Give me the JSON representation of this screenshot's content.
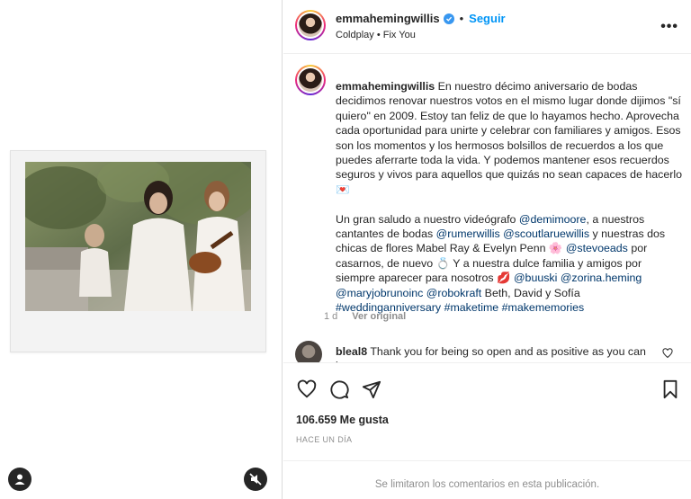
{
  "post": {
    "username": "emmahemingwillis",
    "follow_label": "Seguir",
    "separator": "•",
    "audio": "Coldplay • Fix You",
    "more_label": "•••"
  },
  "caption": {
    "username": "emmahemingwillis",
    "text_1": " En nuestro décimo aniversario de bodas decidimos renovar nuestros votos en el mismo lugar donde dijimos \"sí quiero\" en 2009. Estoy tan feliz de que lo hayamos hecho. Aprovecha cada oportunidad para unirte y celebrar con familiares y amigos. Esos son los momentos y los hermosos bolsillos de recuerdos a los que puedes aferrarte toda la vida. Y podemos mantener esos recuerdos seguros y vivos para aquellos que quizás no sean capaces de hacerlo ",
    "text_2": "Un gran saludo a nuestro videógrafo ",
    "mention_demi": "@demimoore",
    "text_3": ", a nuestros cantantes de bodas ",
    "mention_rumer": "@rumerwillis",
    "mention_scout": "@scoutlaruewillis",
    "text_4": " y nuestras dos chicas de flores Mabel Ray & Evelyn Penn ",
    "mention_steve": "@stevoeads",
    "text_5": " por casarnos, de nuevo ",
    "text_6": " Y a nuestra dulce familia y amigos por siempre aparecer para nosotros ",
    "mention_buuski": "@buuski",
    "mention_zorina": "@zorina.heming",
    "mention_mary": "@maryjobrunoinc",
    "mention_robo": "@robokraft",
    "text_7": " Beth, David y Sofía",
    "tag_1": "#weddinganniversary",
    "tag_2": "#maketime",
    "tag_3": "#makememories",
    "age": "1 d",
    "translate": "Ver original"
  },
  "comment": {
    "username": "bleal8",
    "text": " Thank you for being so open and as positive as you can be."
  },
  "actions": {
    "likes": "106.659 Me gusta",
    "time": "HACE UN DÍA"
  },
  "footer": {
    "text": "Se limitaron los comentarios en esta publicación."
  },
  "colors": {
    "accent": "#0095f6",
    "link": "#00376b",
    "muted": "#8e8e8e"
  }
}
